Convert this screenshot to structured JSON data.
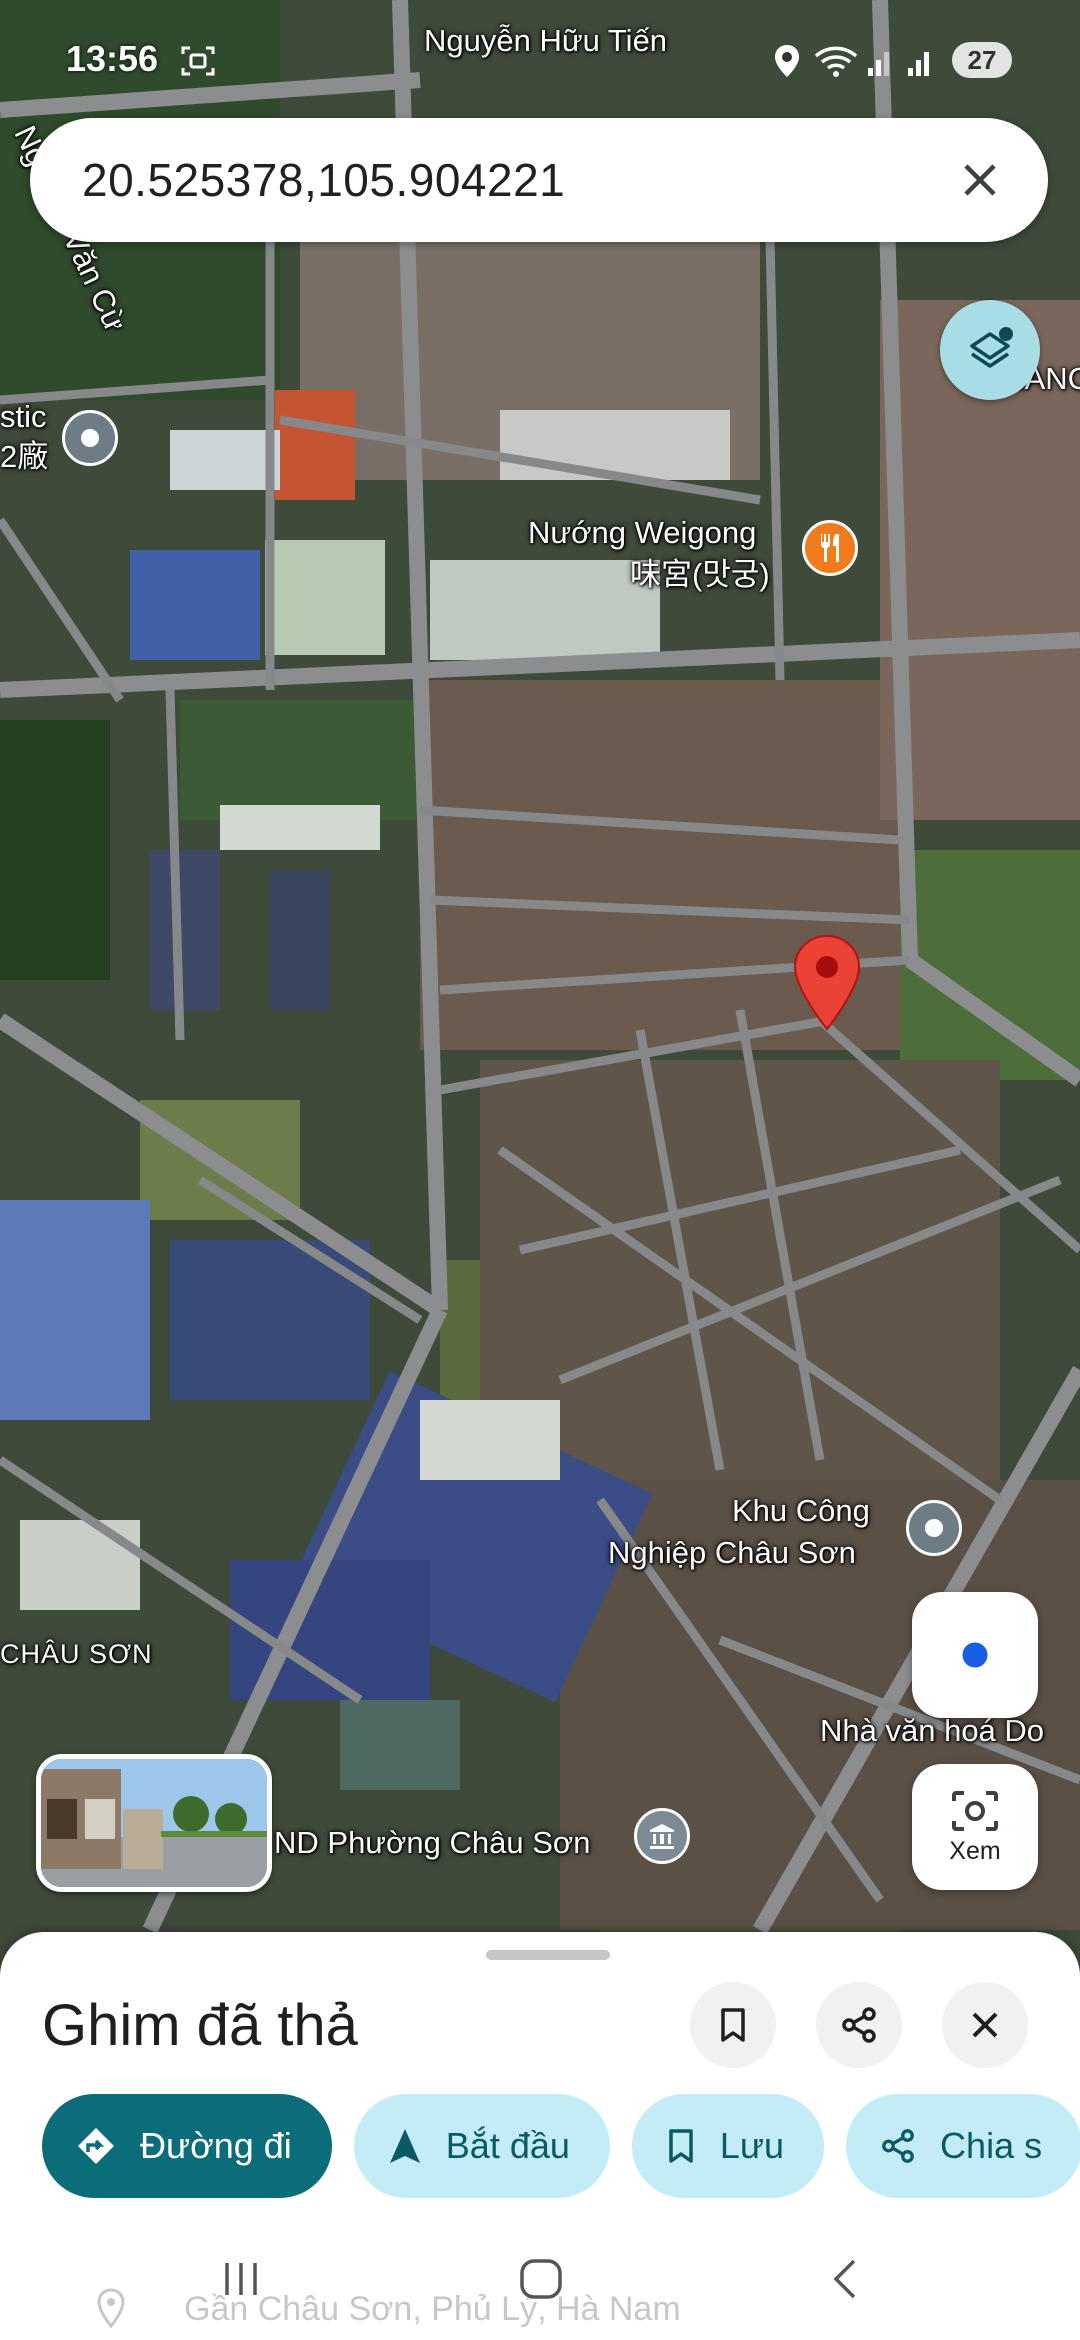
{
  "status_bar": {
    "time": "13:56",
    "battery": "27"
  },
  "search": {
    "query": "20.525378,105.904221"
  },
  "map": {
    "labels": {
      "street_top": "Nguyễn Hữu Tiến",
      "street_left": "Nguyễn Văn Cừ",
      "place_left_1": "stic",
      "place_left_2": "2廠",
      "restaurant_1": "Nướng Weigong",
      "restaurant_2": "味宮(맛궁)",
      "industrial_1": "Khu Công",
      "industrial_2": "Nghiệp Châu Sơn",
      "area": "CHÂU SƠN",
      "culture_house": "Nhà văn hoá Do",
      "ward_office": "ND Phường Châu Sơn",
      "right_edge": "IANC"
    },
    "icons": {
      "layers": "layers-icon",
      "locate": "my-location-icon",
      "lens": "camera-search-icon",
      "pin": "red-pin-icon"
    },
    "accent_pin_color": "#ea4335"
  },
  "lens": {
    "label": "Xem"
  },
  "sheet": {
    "title": "Ghim đã thả",
    "chips": {
      "directions": "Đường đi",
      "start": "Bắt đầu",
      "save": "Lưu",
      "share": "Chia s"
    },
    "address": "Gần Châu Sơn, Phủ Lý, Hà Nam"
  },
  "colors": {
    "primary": "#0c6d7a",
    "chip_bg": "#c3ecf6",
    "chip_text": "#0a5963"
  }
}
